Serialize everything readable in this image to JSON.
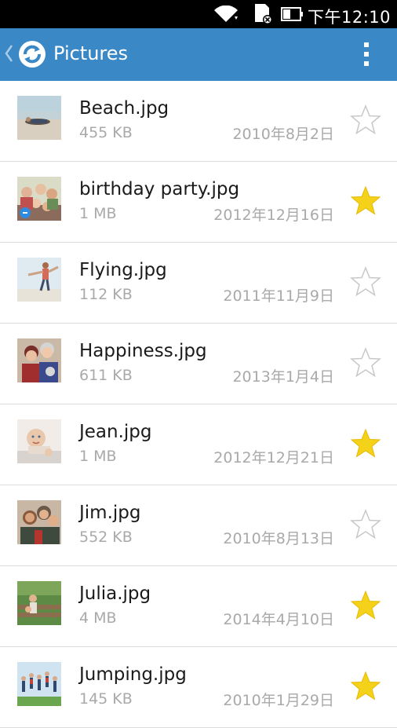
{
  "status_bar": {
    "time": "下午12:10",
    "icons": [
      "wifi-icon",
      "sd-card-error-icon",
      "battery-icon"
    ]
  },
  "app_bar": {
    "title": "Pictures",
    "back_icon": "chevron-left-icon",
    "app_icon": "sync-logo-icon",
    "menu_icon": "overflow-menu-icon"
  },
  "colors": {
    "app_bar_bg": "#3a88c6",
    "star_filled": "#f5d21a",
    "star_outline": "#c8c8c8"
  },
  "files": [
    {
      "name": "Beach.jpg",
      "size": "455 KB",
      "date": "2010年8月2日",
      "starred": false,
      "thumb": "beach"
    },
    {
      "name": "birthday party.jpg",
      "size": "1 MB",
      "date": "2012年12月16日",
      "starred": true,
      "thumb": "party"
    },
    {
      "name": "Flying.jpg",
      "size": "112 KB",
      "date": "2011年11月9日",
      "starred": false,
      "thumb": "flying"
    },
    {
      "name": "Happiness.jpg",
      "size": "611 KB",
      "date": "2013年1月4日",
      "starred": false,
      "thumb": "happiness"
    },
    {
      "name": "Jean.jpg",
      "size": "1 MB",
      "date": "2012年12月21日",
      "starred": true,
      "thumb": "baby"
    },
    {
      "name": "Jim.jpg",
      "size": "552 KB",
      "date": "2010年8月13日",
      "starred": false,
      "thumb": "jim"
    },
    {
      "name": "Julia.jpg",
      "size": "4 MB",
      "date": "2014年4月10日",
      "starred": true,
      "thumb": "julia"
    },
    {
      "name": "Jumping.jpg",
      "size": "145 KB",
      "date": "2010年1月29日",
      "starred": true,
      "thumb": "jumping"
    }
  ]
}
